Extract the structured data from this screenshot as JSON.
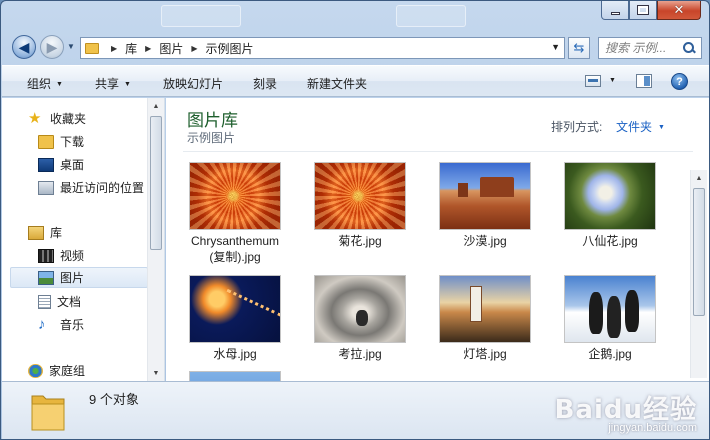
{
  "navigation": {
    "back_glyph": "◀",
    "forward_glyph": "▶",
    "breadcrumb": [
      "库",
      "图片",
      "示例图片"
    ],
    "search_placeholder": "搜索 示例..."
  },
  "toolbar": {
    "organize": "组织",
    "share": "共享",
    "slideshow": "放映幻灯片",
    "burn": "刻录",
    "new_folder": "新建文件夹",
    "help_glyph": "?"
  },
  "sidebar": {
    "favorites": {
      "label": "收藏夹",
      "icon": "star-icon",
      "items": [
        {
          "label": "下载",
          "icon": "download-folder-icon"
        },
        {
          "label": "桌面",
          "icon": "desktop-icon"
        },
        {
          "label": "最近访问的位置",
          "icon": "recent-places-icon"
        }
      ]
    },
    "libraries": {
      "label": "库",
      "icon": "libraries-icon",
      "items": [
        {
          "label": "视频",
          "icon": "video-library-icon"
        },
        {
          "label": "图片",
          "icon": "pictures-library-icon",
          "selected": true
        },
        {
          "label": "文档",
          "icon": "documents-library-icon"
        },
        {
          "label": "音乐",
          "icon": "music-note-icon"
        }
      ]
    },
    "homegroup": {
      "label": "家庭组",
      "icon": "homegroup-icon"
    }
  },
  "content": {
    "title": "图片库",
    "subtitle": "示例图片",
    "arrange_label": "排列方式:",
    "arrange_value": "文件夹",
    "files": [
      {
        "name": "Chrysanthemum (复制).jpg",
        "name_line1": "Chrysanthemum",
        "name_line2": "(复制).jpg",
        "thumb": "chrysanthemum"
      },
      {
        "name": "菊花.jpg",
        "thumb": "chrysanthemum"
      },
      {
        "name": "沙漠.jpg",
        "thumb": "desert"
      },
      {
        "name": "八仙花.jpg",
        "thumb": "hydrangeas"
      },
      {
        "name": "水母.jpg",
        "thumb": "jellyfish"
      },
      {
        "name": "考拉.jpg",
        "thumb": "koala"
      },
      {
        "name": "灯塔.jpg",
        "thumb": "lighthouse"
      },
      {
        "name": "企鹅.jpg",
        "thumb": "penguins"
      }
    ]
  },
  "details": {
    "count": "9 个对象"
  },
  "watermark": {
    "main": "Baidu经验",
    "sub": "jingyan.baidu.com"
  },
  "colors": {
    "library_title": "#1e5f2d",
    "link_blue": "#1b62c4",
    "close_red": "#c8452a"
  }
}
